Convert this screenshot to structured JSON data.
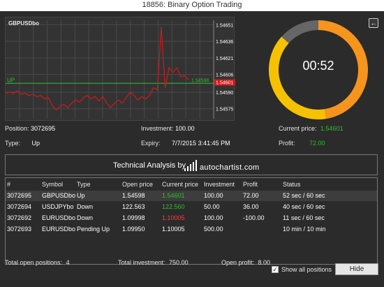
{
  "window": {
    "title": "18856: Binary Option Trading"
  },
  "colors": {
    "green": "#2fbf2f",
    "red": "#ff3b3b",
    "timer_orange": "#f7941d",
    "timer_yellow": "#f6c200",
    "timer_gray": "#666666"
  },
  "chart": {
    "symbol": "GBPUSDbo",
    "direction_label": "UP",
    "open_price_label": "1.54598",
    "current_price_label": "1.54601",
    "y_ticks": [
      "1.54651",
      "1.54636",
      "1.54621",
      "1.54606",
      "1.54590",
      "1.54575"
    ]
  },
  "chart_data": {
    "type": "line",
    "title": "",
    "xlabel": "",
    "ylabel": "",
    "ylim": [
      1.54566,
      1.54655
    ],
    "y": [
      1.54589,
      1.5459,
      1.54589,
      1.54591,
      1.54588,
      1.54589,
      1.54587,
      1.54588,
      1.54586,
      1.54587,
      1.54584,
      1.54585,
      1.54578,
      1.54574,
      1.54577,
      1.54579,
      1.54576,
      1.5458,
      1.54583,
      1.54581,
      1.54585,
      1.54587,
      1.54584,
      1.54586,
      1.54582,
      1.54586,
      1.5458,
      1.54576,
      1.5458,
      1.54583,
      1.5458,
      1.54585,
      1.5459,
      1.54587,
      1.54583,
      1.54586,
      1.54584,
      1.54587,
      1.54594,
      1.54592,
      1.54649,
      1.54594,
      1.54612,
      1.54608,
      1.54612,
      1.54604,
      1.54605,
      1.54601
    ]
  },
  "timer": {
    "remaining": "00:52",
    "elapsed_fraction": 0.1333
  },
  "info": {
    "position_label": "Position:",
    "position_value": "3072695",
    "investment_label": "Investment:",
    "investment_value": "100.00",
    "current_price_label": "Current price:",
    "current_price_value": "1.54601",
    "type_label": "Type:",
    "type_value": "Up",
    "expiry_label": "Expiry:",
    "expiry_value": "7/7/2015 3:41:45 PM",
    "profit_label": "Profit:",
    "profit_value": "72.00"
  },
  "technical": {
    "label": "Technical Analysis by",
    "logo_text": "autochartist.com"
  },
  "table": {
    "headers": [
      "#",
      "Symbol",
      "Type",
      "Open price",
      "Current price",
      "Investment",
      "Profit",
      "Status"
    ],
    "rows": [
      {
        "id": "3072695",
        "symbol": "GBPUSDbo",
        "type": "Up",
        "open": "1.54598",
        "current": "1.54601",
        "current_color": "green",
        "investment": "100.00",
        "profit": "72.00",
        "status": "52 sec / 60 sec"
      },
      {
        "id": "3072694",
        "symbol": "USDJPYbo",
        "type": "Down",
        "open": "122.563",
        "current": "122.560",
        "current_color": "green",
        "investment": "50.00",
        "profit": "36.00",
        "status": "40 sec / 60 sec"
      },
      {
        "id": "3072692",
        "symbol": "EURUSDbo",
        "type": "Down",
        "open": "1.09998",
        "current": "1.10005",
        "current_color": "red",
        "investment": "100.00",
        "profit": "-100.00",
        "status": "11 sec / 60 sec"
      },
      {
        "id": "3072693",
        "symbol": "EURUSDbo",
        "type": "Pending Up",
        "open": "1.09950",
        "current": "1.10005",
        "current_color": "white",
        "investment": "500.00",
        "profit": "",
        "status": "10 min / 10 min"
      }
    ]
  },
  "footer": {
    "total_open_label": "Total open positions:",
    "total_open_value": "4",
    "total_investment_label": "Total investment:",
    "total_investment_value": "750.00",
    "open_profit_label": "Open profit:",
    "open_profit_value": "8.00",
    "show_all_label": "Show all positions",
    "hide_label": "Hide"
  }
}
